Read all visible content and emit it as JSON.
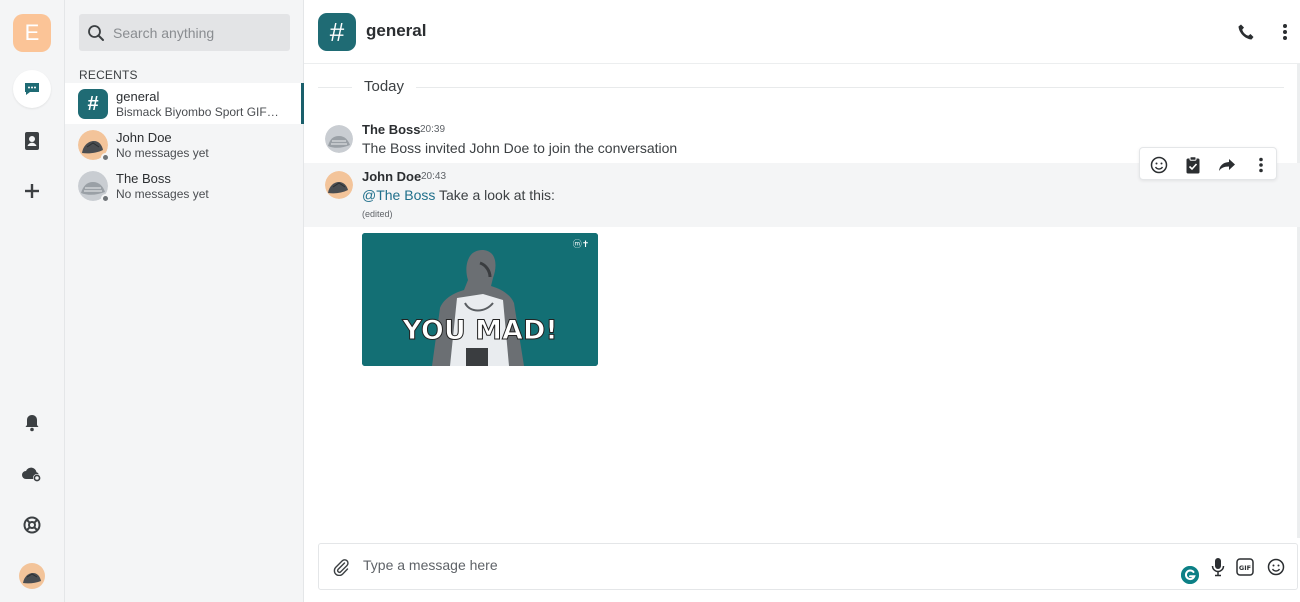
{
  "user": {
    "initial": "E",
    "tile_color": "#fbc497"
  },
  "search": {
    "placeholder": "Search anything"
  },
  "sidebar": {
    "recents_label": "RECENTS"
  },
  "conversations": [
    {
      "name": "general",
      "preview": "Bismack Biyombo Sport GIF by Charlotte Hornets",
      "active": true,
      "type": "channel"
    },
    {
      "name": "John Doe",
      "preview": "No messages yet",
      "active": false,
      "type": "direct"
    },
    {
      "name": "The Boss",
      "preview": "No messages yet",
      "active": false,
      "type": "direct"
    }
  ],
  "channel": {
    "title": "general",
    "hash": "#",
    "accent": "#1f6b74"
  },
  "day_separator": "Today",
  "messages": [
    {
      "author": "The Boss",
      "time": "20:39",
      "text": "The Boss invited John Doe to join the conversation"
    },
    {
      "author": "John Doe",
      "time": "20:43",
      "mention": "@The Boss",
      "text": " Take a look at this:",
      "edited": "(edited)"
    }
  ],
  "gif": {
    "caption": "YOU MAD!",
    "watermark": "Ⓝ†"
  },
  "composer": {
    "placeholder": "Type a message here"
  },
  "icons": {
    "rail": [
      "chat-icon",
      "contacts-icon",
      "plus-icon",
      "bell-icon",
      "cloud-settings-icon",
      "lifebuoy-icon"
    ],
    "header": [
      "phone-icon",
      "more-vertical-icon"
    ],
    "message_actions": [
      "emoji-icon",
      "clipboard-icon",
      "forward-icon",
      "more-vertical-icon"
    ],
    "composer": [
      "paperclip-icon",
      "grammarly-icon",
      "microphone-icon",
      "gif-icon",
      "emoji-icon"
    ]
  }
}
